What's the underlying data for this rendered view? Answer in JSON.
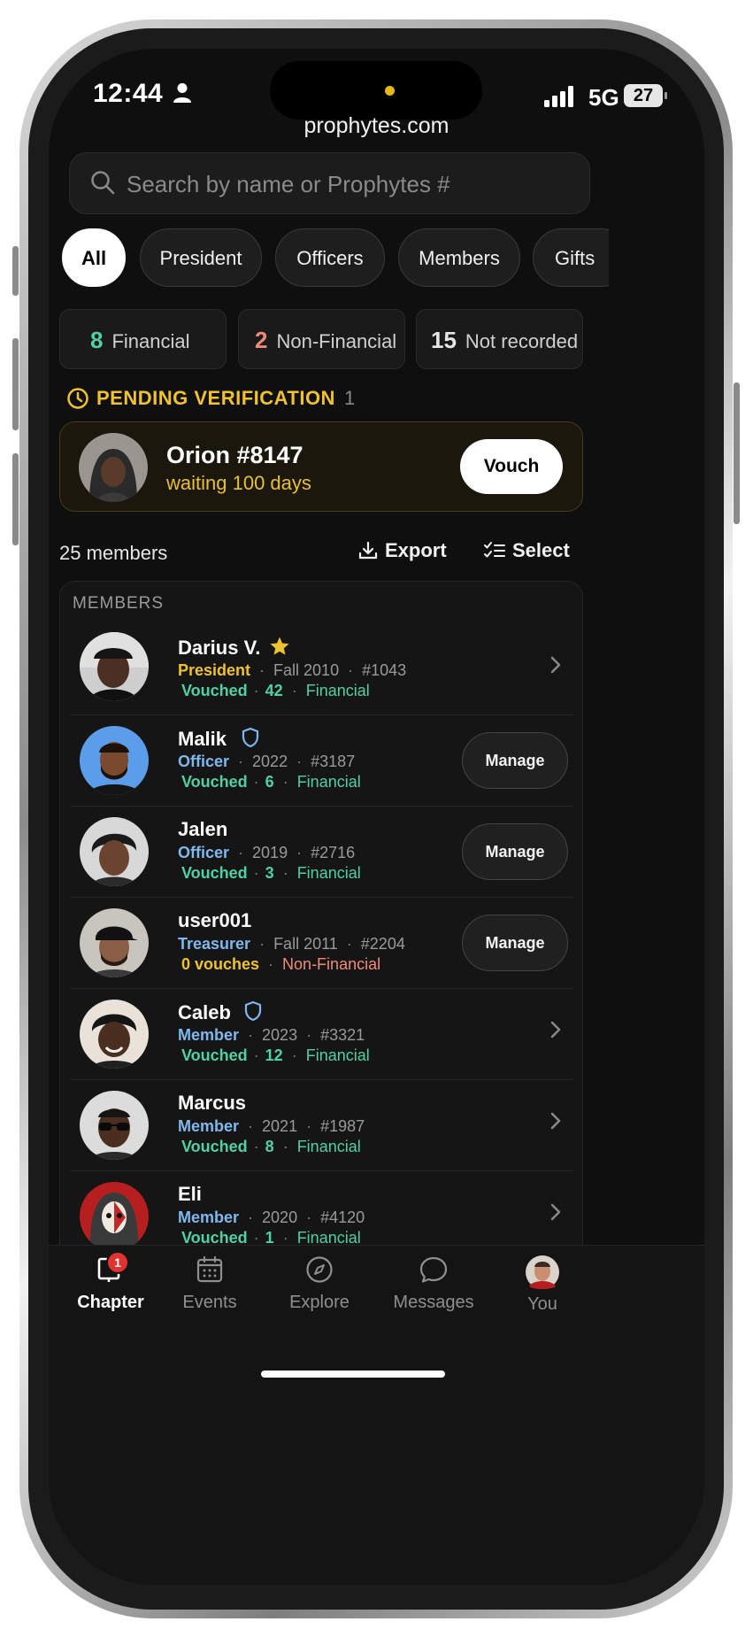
{
  "status": {
    "time": "12:44",
    "network": "5G",
    "battery": "27"
  },
  "browser": {
    "url": "prophytes.com"
  },
  "search": {
    "placeholder": "Search by name or Prophytes #"
  },
  "filters": [
    "All",
    "President",
    "Officers",
    "Members",
    "Gifts"
  ],
  "stats": [
    {
      "num": "8",
      "label": "Financial",
      "color": "#4fd1a5"
    },
    {
      "num": "2",
      "label": "Non-Financial",
      "color": "#f08a78"
    },
    {
      "num": "15",
      "label": "Not recorded",
      "color": "#e6e6e6"
    }
  ],
  "pending": {
    "label": "PENDING VERIFICATION",
    "count": "1",
    "name": "Orion #8147",
    "subtitle": "waiting 100 days",
    "button": "Vouch"
  },
  "list": {
    "count_text": "25 members",
    "export_label": "Export",
    "select_label": "Select",
    "header": "MEMBERS",
    "manage_label": "Manage"
  },
  "members": [
    {
      "name": "Darius V.",
      "role": "President",
      "year": "Fall 2010",
      "number": "#1043",
      "vouch": "Vouched",
      "vouch_count": "42",
      "status": "Financial"
    },
    {
      "name": "Malik",
      "role": "Officer",
      "year": "2022",
      "number": "#3187",
      "vouch": "Vouched",
      "vouch_count": "6",
      "status": "Financial"
    },
    {
      "name": "Jalen",
      "role": "Officer",
      "year": "2019",
      "number": "#2716",
      "vouch": "Vouched",
      "vouch_count": "3",
      "status": "Financial"
    },
    {
      "name": "user001",
      "role": "Treasurer",
      "year": "Fall 2011",
      "number": "#2204",
      "vouch": "0 vouches",
      "vouch_count": "",
      "status": "Non-Financial"
    },
    {
      "name": "Caleb",
      "role": "Member",
      "year": "2023",
      "number": "#3321",
      "vouch": "Vouched",
      "vouch_count": "12",
      "status": "Financial"
    },
    {
      "name": "Marcus",
      "role": "Member",
      "year": "2021",
      "number": "#1987",
      "vouch": "Vouched",
      "vouch_count": "8",
      "status": "Financial"
    },
    {
      "name": "Eli",
      "role": "Member",
      "year": "2020",
      "number": "#4120",
      "vouch": "Vouched",
      "vouch_count": "1",
      "status": "Financial"
    }
  ],
  "tabs": {
    "chapter": "Chapter",
    "chapter_badge": "1",
    "events": "Events",
    "explore": "Explore",
    "messages": "Messages",
    "you": "You"
  },
  "colors": {
    "accent_gold": "#f0c22c",
    "financial_green": "#4fd1a5",
    "non_financial_red": "#f08a78",
    "role_blue": "#7fb8ee"
  }
}
